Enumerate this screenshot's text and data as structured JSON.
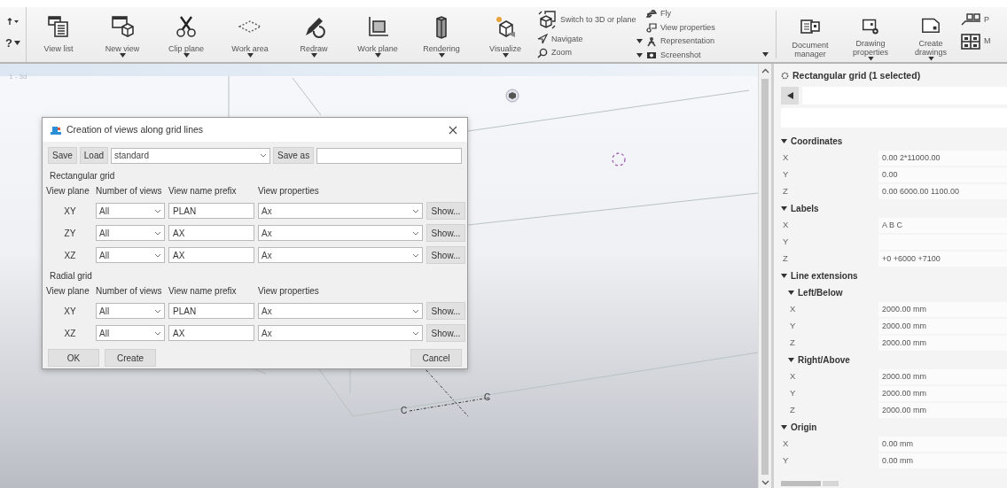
{
  "ribbon": {
    "edge_items": [
      {
        "label": "?",
        "dropdown": true
      }
    ],
    "tools": [
      {
        "label": "View list",
        "dropdown": false
      },
      {
        "label": "New view",
        "dropdown": true
      },
      {
        "label": "Clip plane",
        "dropdown": true
      },
      {
        "label": "Work area",
        "dropdown": true
      },
      {
        "label": "Redraw",
        "dropdown": true
      },
      {
        "label": "Work plane",
        "dropdown": true
      },
      {
        "label": "Rendering",
        "dropdown": true
      },
      {
        "label": "Visualize",
        "dropdown": true
      }
    ],
    "quick_left": [
      {
        "label": "Switch to 3D or plane"
      },
      {
        "label": "Navigate"
      },
      {
        "label": "Zoom"
      }
    ],
    "quick_right": [
      {
        "label": "Fly",
        "dropdown": false
      },
      {
        "label": "View properties",
        "dropdown": false
      },
      {
        "label": "Representation",
        "dropdown": true
      },
      {
        "label": "Screenshot",
        "dropdown": true
      }
    ],
    "drawing_tools": [
      {
        "label": "Document manager",
        "dropdown": false
      },
      {
        "label": "Drawing properties",
        "dropdown": true
      },
      {
        "label": "Create drawings",
        "dropdown": true
      }
    ],
    "cut_items": [
      {
        "label": "P"
      },
      {
        "label": "M"
      }
    ]
  },
  "viewport": {
    "title": "1 - 3d",
    "grid_labels": [
      "C",
      "C"
    ]
  },
  "dialog": {
    "title": "Creation of views along grid lines",
    "toolbar": {
      "save": "Save",
      "load": "Load",
      "preset": "standard",
      "save_as": "Save as"
    },
    "sections": [
      {
        "title": "Rectangular grid",
        "columns": [
          "View plane",
          "Number of views",
          "View name prefix",
          "View properties"
        ],
        "rows": [
          {
            "plane": "XY",
            "count": "All",
            "prefix": "PLAN",
            "properties": "Ax",
            "show": "Show..."
          },
          {
            "plane": "ZY",
            "count": "All",
            "prefix": "AX",
            "properties": "Ax",
            "show": "Show..."
          },
          {
            "plane": "XZ",
            "count": "All",
            "prefix": "AX",
            "properties": "Ax",
            "show": "Show..."
          }
        ]
      },
      {
        "title": "Radial grid",
        "columns": [
          "View plane",
          "Number of views",
          "View name prefix",
          "View properties"
        ],
        "rows": [
          {
            "plane": "XY",
            "count": "All",
            "prefix": "PLAN",
            "properties": "Ax",
            "show": "Show..."
          },
          {
            "plane": "XZ",
            "count": "All",
            "prefix": "AX",
            "properties": "Ax",
            "show": "Show..."
          }
        ]
      }
    ],
    "buttons": {
      "ok": "OK",
      "create": "Create",
      "cancel": "Cancel"
    }
  },
  "properties": {
    "title": "Rectangular grid (1 selected)",
    "sections": [
      {
        "title": "Coordinates",
        "expanded": true,
        "rows": [
          {
            "label": "X",
            "value": "0.00 2*11000.00"
          },
          {
            "label": "Y",
            "value": "0.00"
          },
          {
            "label": "Z",
            "value": "0.00 6000.00 1100.00"
          }
        ]
      },
      {
        "title": "Labels",
        "expanded": true,
        "rows": [
          {
            "label": "X",
            "value": "A B C"
          },
          {
            "label": "Y"
          },
          {
            "label": "Z",
            "value": "+0 +6000 +7100"
          }
        ]
      },
      {
        "title": "Line extensions",
        "expanded": true,
        "children": [
          {
            "title": "Left/Below",
            "expanded": true,
            "rows": [
              {
                "label": "X",
                "value": "2000.00 mm"
              },
              {
                "label": "Y",
                "value": "2000.00 mm"
              },
              {
                "label": "Z",
                "value": "2000.00 mm"
              }
            ]
          },
          {
            "title": "Right/Above",
            "expanded": true,
            "rows": [
              {
                "label": "X",
                "value": "2000.00 mm"
              },
              {
                "label": "Y",
                "value": "2000.00 mm"
              },
              {
                "label": "Z",
                "value": "2000.00 mm"
              }
            ]
          }
        ]
      },
      {
        "title": "Origin",
        "expanded": true,
        "rows": [
          {
            "label": "X",
            "value": "0.00 mm"
          },
          {
            "label": "Y",
            "value": "0.00 mm"
          }
        ]
      }
    ]
  }
}
